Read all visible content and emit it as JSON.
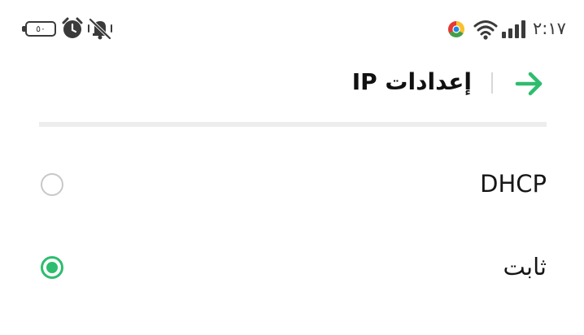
{
  "status_bar": {
    "battery_level": "٥٠",
    "time": "٢:١٧",
    "icons": [
      "battery-icon",
      "alarm-icon",
      "mute-icon",
      "chrome-icon",
      "wifi-icon",
      "signal-icon"
    ]
  },
  "header": {
    "title": "إعدادات IP",
    "back_icon": "arrow-back-icon"
  },
  "options": [
    {
      "label": "DHCP",
      "selected": false
    },
    {
      "label": "ثابت",
      "selected": true
    }
  ],
  "colors": {
    "accent": "#2ebd6e",
    "radio_off": "#c8c8c8",
    "divider": "#ededed",
    "text": "#111111",
    "status_icons": "#3a3a3a"
  }
}
